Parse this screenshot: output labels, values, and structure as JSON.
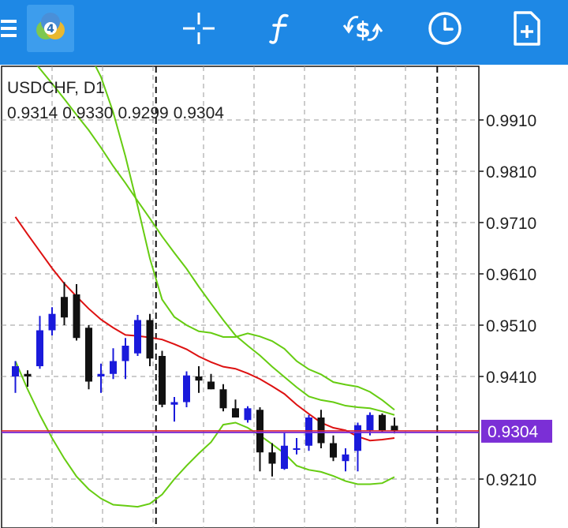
{
  "toolbar": {
    "menu_icon": "hamburger-menu-icon",
    "logo_icon": "metatrader-logo-icon",
    "logo_text": "4",
    "crosshair_icon": "crosshair-icon",
    "indicators_icon": "function-icon",
    "trade_icon": "dollar-exchange-icon",
    "timeframe_icon": "clock-icon",
    "new_order_icon": "document-plus-icon",
    "background_color": "#1e88e5"
  },
  "chart": {
    "symbol": "USDCHF, D1",
    "ohlc": {
      "open": "0.9314",
      "high": "0.9330",
      "low": "0.9299",
      "close": "0.9304"
    },
    "current_price": "0.9304",
    "colors": {
      "bull": "#1a1adb",
      "bear": "#111111",
      "ma": "#dd1111",
      "bands": "#66cc11",
      "price_line": "#7b2fd6",
      "price_badge": "#7b2fd6"
    }
  },
  "chart_data": {
    "type": "candlestick",
    "symbol": "USDCHF",
    "timeframe": "D1",
    "price_axis_ticks": [
      "0.9910",
      "0.9810",
      "0.9710",
      "0.9610",
      "0.9510",
      "0.9410",
      "0.9210"
    ],
    "ylim": [
      0.9174,
      0.9991
    ],
    "current_price": 0.9304,
    "candles": [
      {
        "o": 0.941,
        "h": 0.944,
        "l": 0.9378,
        "c": 0.943
      },
      {
        "o": 0.9415,
        "h": 0.9422,
        "l": 0.939,
        "c": 0.941
      },
      {
        "o": 0.943,
        "h": 0.9528,
        "l": 0.9425,
        "c": 0.95
      },
      {
        "o": 0.95,
        "h": 0.9545,
        "l": 0.949,
        "c": 0.9532
      },
      {
        "o": 0.9565,
        "h": 0.9594,
        "l": 0.951,
        "c": 0.9525
      },
      {
        "o": 0.957,
        "h": 0.959,
        "l": 0.948,
        "c": 0.9485
      },
      {
        "o": 0.9505,
        "h": 0.951,
        "l": 0.9385,
        "c": 0.94
      },
      {
        "o": 0.941,
        "h": 0.9435,
        "l": 0.9378,
        "c": 0.9415
      },
      {
        "o": 0.9415,
        "h": 0.9465,
        "l": 0.9405,
        "c": 0.944
      },
      {
        "o": 0.944,
        "h": 0.9485,
        "l": 0.9405,
        "c": 0.947
      },
      {
        "o": 0.9455,
        "h": 0.953,
        "l": 0.945,
        "c": 0.952
      },
      {
        "o": 0.952,
        "h": 0.9532,
        "l": 0.943,
        "c": 0.9445
      },
      {
        "o": 0.945,
        "h": 0.946,
        "l": 0.935,
        "c": 0.9355
      },
      {
        "o": 0.9355,
        "h": 0.937,
        "l": 0.9322,
        "c": 0.936
      },
      {
        "o": 0.936,
        "h": 0.942,
        "l": 0.935,
        "c": 0.9412
      },
      {
        "o": 0.941,
        "h": 0.943,
        "l": 0.9378,
        "c": 0.9402
      },
      {
        "o": 0.94,
        "h": 0.9415,
        "l": 0.9385,
        "c": 0.9385
      },
      {
        "o": 0.9385,
        "h": 0.9395,
        "l": 0.9342,
        "c": 0.9348
      },
      {
        "o": 0.9348,
        "h": 0.9365,
        "l": 0.933,
        "c": 0.933
      },
      {
        "o": 0.9325,
        "h": 0.9352,
        "l": 0.932,
        "c": 0.9348
      },
      {
        "o": 0.9345,
        "h": 0.935,
        "l": 0.9225,
        "c": 0.9262
      },
      {
        "o": 0.9262,
        "h": 0.928,
        "l": 0.9215,
        "c": 0.924
      },
      {
        "o": 0.923,
        "h": 0.93,
        "l": 0.9228,
        "c": 0.9275
      },
      {
        "o": 0.927,
        "h": 0.929,
        "l": 0.9258,
        "c": 0.927
      },
      {
        "o": 0.9275,
        "h": 0.9335,
        "l": 0.9265,
        "c": 0.933
      },
      {
        "o": 0.933,
        "h": 0.9345,
        "l": 0.927,
        "c": 0.928
      },
      {
        "o": 0.928,
        "h": 0.9295,
        "l": 0.9245,
        "c": 0.9252
      },
      {
        "o": 0.9245,
        "h": 0.927,
        "l": 0.9225,
        "c": 0.9258
      },
      {
        "o": 0.9265,
        "h": 0.932,
        "l": 0.9225,
        "c": 0.9315
      },
      {
        "o": 0.9305,
        "h": 0.934,
        "l": 0.9295,
        "c": 0.9335
      },
      {
        "o": 0.9335,
        "h": 0.9338,
        "l": 0.93,
        "c": 0.9305
      },
      {
        "o": 0.9314,
        "h": 0.933,
        "l": 0.9299,
        "c": 0.9304
      }
    ],
    "moving_average": [
      0.9721,
      0.9687,
      0.9654,
      0.9621,
      0.9591,
      0.9566,
      0.9542,
      0.9521,
      0.9505,
      0.9491,
      0.9489,
      0.9486,
      0.9482,
      0.9473,
      0.9463,
      0.9449,
      0.9438,
      0.9429,
      0.9425,
      0.9416,
      0.9405,
      0.9391,
      0.9376,
      0.9355,
      0.9337,
      0.932,
      0.931,
      0.9305,
      0.9293,
      0.9285,
      0.9287,
      0.929
    ],
    "band_upper": [
      1.0071,
      1.004,
      1.001,
      0.9981,
      0.9951,
      0.992,
      0.989,
      0.9856,
      0.982,
      0.9787,
      0.9752,
      0.9718,
      0.9683,
      0.9651,
      0.962,
      0.9585,
      0.9552,
      0.952,
      0.949,
      0.947,
      0.9451,
      0.9429,
      0.9409,
      0.9389,
      0.9371,
      0.9364,
      0.936,
      0.9353,
      0.935,
      0.9348,
      0.9342,
      0.9335
    ],
    "band_lower": [
      0.944,
      0.9385,
      0.9335,
      0.929,
      0.925,
      0.9215,
      0.919,
      0.9172,
      0.916,
      0.9158,
      0.9156,
      0.9162,
      0.918,
      0.921,
      0.9236,
      0.926,
      0.9282,
      0.9316,
      0.932,
      0.931,
      0.9295,
      0.9278,
      0.926,
      0.9236,
      0.9228,
      0.9224,
      0.9216,
      0.9206,
      0.92,
      0.92,
      0.9202,
      0.9214
    ],
    "band_upper_wide": [
      1.0281,
      1.024,
      1.02,
      1.016,
      1.0121,
      1.0086,
      1.0041,
      0.9994,
      0.9925,
      0.9839,
      0.9742,
      0.964,
      0.956,
      0.9526,
      0.951,
      0.9498,
      0.9495,
      0.9487,
      0.9487,
      0.9494,
      0.9488,
      0.9479,
      0.9464,
      0.944,
      0.9424,
      0.9414,
      0.9399,
      0.9394,
      0.939,
      0.938,
      0.9364,
      0.9345
    ],
    "session_separators_candle_index": [
      11.5,
      34.5
    ],
    "grid": true
  }
}
